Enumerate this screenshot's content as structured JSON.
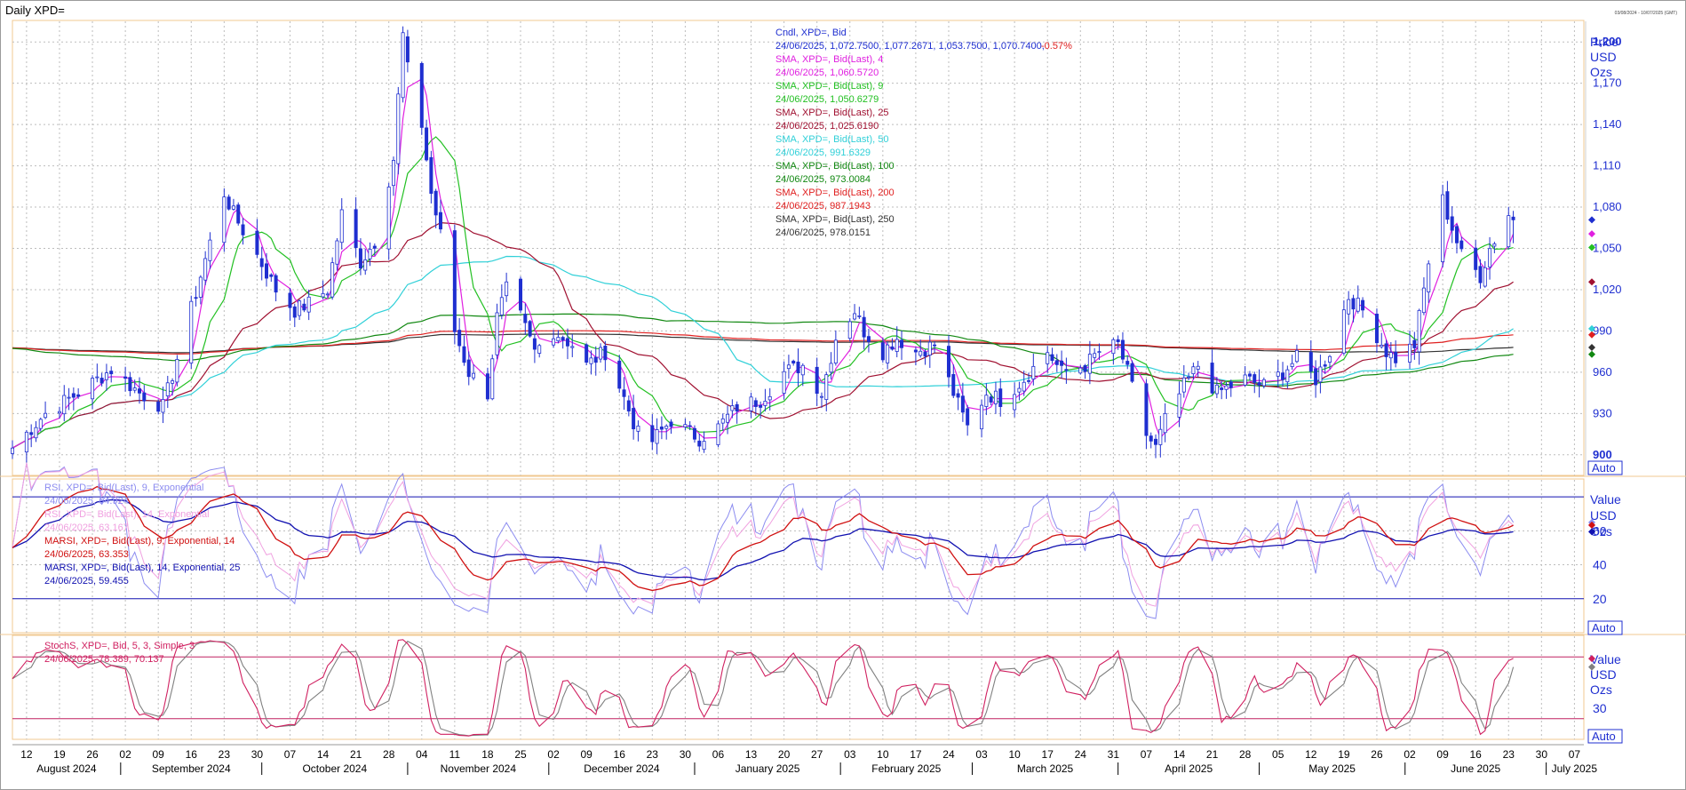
{
  "window": {
    "title": "Daily XPD=",
    "range": "03/08/2024 - 10/07/2025 (GMT)"
  },
  "colors": {
    "candle": "#1f2fd0",
    "sma4": "#e020e0",
    "sma9": "#22c022",
    "sma25": "#a01030",
    "sma50": "#30d0d8",
    "sma100": "#118811",
    "sma200": "#e02020",
    "sma250": "#333333",
    "rsi9": "#8c8cf0",
    "rsi14": "#f0a0e0",
    "marsi9": "#d01010",
    "marsi14": "#1010b0",
    "stoch_k": "#d02060",
    "stoch_d": "#808080",
    "grid": "#bdbdbd",
    "panel_border": "#f0c890"
  },
  "price_panel": {
    "axis_label": [
      "Price",
      "USD",
      "Ozs"
    ],
    "auto_label": "Auto",
    "legend": [
      {
        "line1": "Cndl, XPD=, Bid",
        "line2": "24/06/2025, 1,072.7500, 1,077.2671, 1,053.7500, 1,070.7400,",
        "change": "-0.57%",
        "color": "#1f2fd0"
      },
      {
        "line1": "SMA, XPD=, Bid(Last),  4",
        "line2": "24/06/2025, 1,060.5720",
        "color": "#e020e0"
      },
      {
        "line1": "SMA, XPD=, Bid(Last),  9",
        "line2": "24/06/2025, 1,050.6279",
        "color": "#22c022"
      },
      {
        "line1": "SMA, XPD=, Bid(Last),  25",
        "line2": "24/06/2025, 1,025.6190",
        "color": "#a01030"
      },
      {
        "line1": "SMA, XPD=, Bid(Last),  50",
        "line2": "24/06/2025, 991.6329",
        "color": "#30d0d8"
      },
      {
        "line1": "SMA, XPD=, Bid(Last),  100",
        "line2": "24/06/2025, 973.0084",
        "color": "#118811"
      },
      {
        "line1": "SMA, XPD=, Bid(Last),  200",
        "line2": "24/06/2025, 987.1943",
        "color": "#e02020"
      },
      {
        "line1": "SMA, XPD=, Bid(Last),  250",
        "line2": "24/06/2025, 978.0151",
        "color": "#333333"
      }
    ]
  },
  "rsi_panel": {
    "axis_label": [
      "Value",
      "USD",
      "Ozs"
    ],
    "auto_label": "Auto",
    "ticks": [
      "20",
      "40",
      "60"
    ],
    "legend": [
      {
        "line1": "RSI, XPD=, Bid(Last),  9, Exponential",
        "line2": "24/06/2025, 64.924",
        "color": "#8c8cf0"
      },
      {
        "line1": "RSI, XPD=, Bid(Last),  14, Exponential",
        "line2": "24/06/2025, 63.167",
        "color": "#f0a0e0"
      },
      {
        "line1": "MARSI, XPD=, Bid(Last),  9, Exponential, 14",
        "line2": "24/06/2025, 63.353",
        "color": "#d01010"
      },
      {
        "line1": "MARSI, XPD=, Bid(Last),  14, Exponential, 25",
        "line2": "24/06/2025, 59.455",
        "color": "#1010b0"
      }
    ]
  },
  "stoch_panel": {
    "axis_label": [
      "Value",
      "USD",
      "Ozs"
    ],
    "auto_label": "Auto",
    "ticks": [
      "30"
    ],
    "legend": [
      {
        "line1": "StochS, XPD=, Bid,  5, 3, Simple, 3",
        "line2": "24/06/2025, 78.389, 70.137",
        "color": "#d02060"
      }
    ]
  },
  "time_axis": {
    "day_ticks": [
      "12",
      "19",
      "26",
      "02",
      "09",
      "16",
      "23",
      "30",
      "07",
      "14",
      "21",
      "28",
      "04",
      "11",
      "18",
      "25",
      "02",
      "09",
      "16",
      "23",
      "30",
      "06",
      "13",
      "20",
      "27",
      "03",
      "10",
      "17",
      "24",
      "03",
      "10",
      "17",
      "24",
      "31",
      "07",
      "14",
      "21",
      "28",
      "05",
      "12",
      "19",
      "26",
      "02",
      "09",
      "16",
      "23",
      "30",
      "07"
    ],
    "months": [
      "August 2024",
      "September 2024",
      "October 2024",
      "November 2024",
      "December 2024",
      "January 2025",
      "February 2025",
      "March 2025",
      "April 2025",
      "May 2025",
      "June 2025",
      "July 2025"
    ]
  },
  "chart_data": [
    {
      "type": "candlestick",
      "title": "Daily XPD=",
      "ylabel": "Price USD Ozs",
      "yticks": [
        900,
        930,
        960,
        990,
        1020,
        1050,
        1080,
        1110,
        1140,
        1170,
        1200
      ],
      "ylim": [
        885,
        1215
      ],
      "x_start": "2024-08-09",
      "x_end": "2025-07-09",
      "grid": true,
      "last_bar": {
        "date": "24/06/2025",
        "open": 1072.75,
        "high": 1077.2671,
        "low": 1053.75,
        "close": 1070.74
      },
      "close_anchors": [
        [
          "2024-08-09",
          905
        ],
        [
          "2024-08-16",
          930
        ],
        [
          "2024-08-23",
          945
        ],
        [
          "2024-08-30",
          962
        ],
        [
          "2024-09-05",
          945
        ],
        [
          "2024-09-10",
          935
        ],
        [
          "2024-09-13",
          970
        ],
        [
          "2024-09-18",
          1030
        ],
        [
          "2024-09-23",
          1090
        ],
        [
          "2024-09-25",
          1075
        ],
        [
          "2024-09-30",
          1045
        ],
        [
          "2024-10-04",
          1020
        ],
        [
          "2024-10-08",
          1005
        ],
        [
          "2024-10-11",
          1010
        ],
        [
          "2024-10-15",
          1020
        ],
        [
          "2024-10-18",
          1075
        ],
        [
          "2024-10-22",
          1040
        ],
        [
          "2024-10-25",
          1055
        ],
        [
          "2024-10-29",
          1115
        ],
        [
          "2024-10-31",
          1205
        ],
        [
          "2024-11-01",
          1180
        ],
        [
          "2024-11-04",
          1140
        ],
        [
          "2024-11-06",
          1090
        ],
        [
          "2024-11-08",
          1060
        ],
        [
          "2024-11-11",
          990
        ],
        [
          "2024-11-14",
          960
        ],
        [
          "2024-11-18",
          945
        ],
        [
          "2024-11-20",
          1000
        ],
        [
          "2024-11-22",
          1020
        ],
        [
          "2024-11-25",
          1000
        ],
        [
          "2024-11-28",
          975
        ],
        [
          "2024-12-02",
          990
        ],
        [
          "2024-12-06",
          980
        ],
        [
          "2024-12-09",
          965
        ],
        [
          "2024-12-13",
          975
        ],
        [
          "2024-12-16",
          950
        ],
        [
          "2024-12-20",
          915
        ],
        [
          "2024-12-23",
          910
        ],
        [
          "2024-12-27",
          925
        ],
        [
          "2025-01-02",
          912
        ],
        [
          "2025-01-06",
          920
        ],
        [
          "2025-01-10",
          935
        ],
        [
          "2025-01-15",
          940
        ],
        [
          "2025-01-20",
          960
        ],
        [
          "2025-01-24",
          965
        ],
        [
          "2025-01-28",
          945
        ],
        [
          "2025-01-31",
          985
        ],
        [
          "2025-02-04",
          1005
        ],
        [
          "2025-02-06",
          990
        ],
        [
          "2025-02-10",
          975
        ],
        [
          "2025-02-13",
          985
        ],
        [
          "2025-02-17",
          975
        ],
        [
          "2025-02-21",
          980
        ],
        [
          "2025-02-25",
          945
        ],
        [
          "2025-02-28",
          920
        ],
        [
          "2025-03-04",
          945
        ],
        [
          "2025-03-07",
          940
        ],
        [
          "2025-03-12",
          955
        ],
        [
          "2025-03-17",
          975
        ],
        [
          "2025-03-20",
          960
        ],
        [
          "2025-03-25",
          965
        ],
        [
          "2025-03-28",
          975
        ],
        [
          "2025-04-01",
          980
        ],
        [
          "2025-04-03",
          960
        ],
        [
          "2025-04-07",
          915
        ],
        [
          "2025-04-09",
          905
        ],
        [
          "2025-04-11",
          925
        ],
        [
          "2025-04-15",
          950
        ],
        [
          "2025-04-18",
          965
        ],
        [
          "2025-04-22",
          945
        ],
        [
          "2025-04-28",
          955
        ],
        [
          "2025-05-02",
          950
        ],
        [
          "2025-05-06",
          960
        ],
        [
          "2025-05-09",
          970
        ],
        [
          "2025-05-13",
          955
        ],
        [
          "2025-05-16",
          975
        ],
        [
          "2025-05-20",
          1015
        ],
        [
          "2025-05-23",
          1005
        ],
        [
          "2025-05-28",
          975
        ],
        [
          "2025-05-30",
          970
        ],
        [
          "2025-06-03",
          980
        ],
        [
          "2025-06-06",
          1040
        ],
        [
          "2025-06-09",
          1085
        ],
        [
          "2025-06-11",
          1065
        ],
        [
          "2025-06-13",
          1045
        ],
        [
          "2025-06-17",
          1030
        ],
        [
          "2025-06-19",
          1050
        ],
        [
          "2025-06-23",
          1075
        ],
        [
          "2025-06-24",
          1071
        ]
      ],
      "series": [
        {
          "name": "SMA, XPD=, Bid(Last), 4",
          "last": 1060.572
        },
        {
          "name": "SMA, XPD=, Bid(Last), 9",
          "last": 1050.6279
        },
        {
          "name": "SMA, XPD=, Bid(Last), 25",
          "last": 1025.619
        },
        {
          "name": "SMA, XPD=, Bid(Last), 50",
          "last": 991.6329
        },
        {
          "name": "SMA, XPD=, Bid(Last), 100",
          "last": 973.0084
        },
        {
          "name": "SMA, XPD=, Bid(Last), 200",
          "last": 987.1943
        },
        {
          "name": "SMA, XPD=, Bid(Last), 250",
          "last": 978.0151
        }
      ]
    },
    {
      "type": "line",
      "ylabel": "Value USD Ozs",
      "yticks": [
        20,
        40,
        60
      ],
      "ylim": [
        0,
        90
      ],
      "ref_lines": [
        20,
        80
      ],
      "series": [
        {
          "name": "RSI, XPD=, Bid(Last), 9, Exponential",
          "last": 64.924
        },
        {
          "name": "RSI, XPD=, Bid(Last), 14, Exponential",
          "last": 63.167
        },
        {
          "name": "MARSI, XPD=, Bid(Last), 9, Exponential, 14",
          "last": 63.353
        },
        {
          "name": "MARSI, XPD=, Bid(Last), 14, Exponential, 25",
          "last": 59.455
        }
      ]
    },
    {
      "type": "line",
      "ylabel": "Value USD Ozs",
      "yticks": [
        30
      ],
      "ylim": [
        0,
        100
      ],
      "ref_lines": [
        20,
        80
      ],
      "series": [
        {
          "name": "StochS, XPD=, Bid, 5, 3, Simple, 3 (%K)",
          "last": 78.389
        },
        {
          "name": "StochS, XPD=, Bid, 5, 3, Simple, 3 (%D)",
          "last": 70.137
        }
      ]
    }
  ]
}
